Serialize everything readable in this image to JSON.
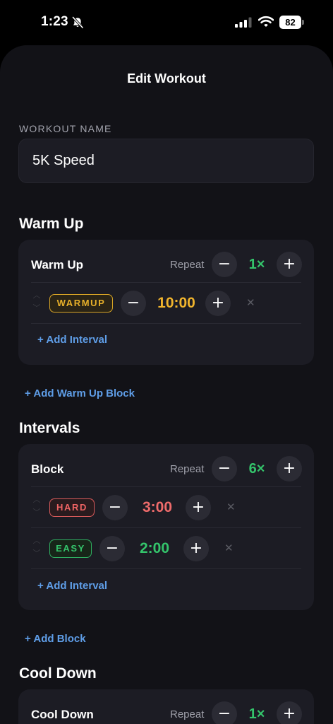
{
  "status_bar": {
    "time": "1:23",
    "battery": "82"
  },
  "header": {
    "title": "Edit Workout"
  },
  "workout_name": {
    "label": "WORKOUT NAME",
    "value": "5K Speed"
  },
  "sections": {
    "warm_up": {
      "title": "Warm Up",
      "block": {
        "name": "Warm Up",
        "repeat_label": "Repeat",
        "repeat_value": "1×",
        "intervals": [
          {
            "tag": "WARMUP",
            "time": "10:00"
          }
        ],
        "add_interval": "+ Add Interval"
      },
      "add_block": "+ Add Warm Up Block"
    },
    "intervals": {
      "title": "Intervals",
      "block": {
        "name": "Block",
        "repeat_label": "Repeat",
        "repeat_value": "6×",
        "intervals": [
          {
            "tag": "HARD",
            "time": "3:00"
          },
          {
            "tag": "EASY",
            "time": "2:00"
          }
        ],
        "add_interval": "+ Add Interval"
      },
      "add_block": "+ Add Block"
    },
    "cool_down": {
      "title": "Cool Down",
      "block": {
        "name": "Cool Down",
        "repeat_label": "Repeat",
        "repeat_value": "1×"
      }
    }
  },
  "controls": {
    "minus": "−",
    "plus": "+",
    "remove": "✕",
    "up": "︿",
    "down": "﹀"
  },
  "colors": {
    "warmup": "#F0B42D",
    "hard": "#EF6464",
    "easy": "#34C46B",
    "link": "#5F9EE8",
    "repeat_value": "#34C46B"
  },
  "icons": [
    "bell-slash-icon",
    "cellular-signal-icon",
    "wifi-icon",
    "battery-icon",
    "minus-icon",
    "plus-icon",
    "close-icon",
    "chevron-up-icon",
    "chevron-down-icon"
  ]
}
